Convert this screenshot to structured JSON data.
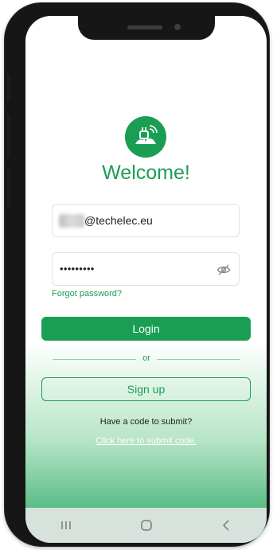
{
  "welcome": {
    "title": "Welcome!"
  },
  "email": {
    "value": "@techelec.eu"
  },
  "password": {
    "masked": "•••••••••"
  },
  "links": {
    "forgot": "Forgot password?",
    "submit_code": "Click here to submit code."
  },
  "buttons": {
    "login": "Login",
    "signup": "Sign up"
  },
  "divider": {
    "label": "or"
  },
  "code_prompt": "Have a code to submit?",
  "icons": {
    "logo": "ev-charger-plug-logo",
    "password_toggle": "eye-slash-icon",
    "nav_recents": "recent-apps-icon",
    "nav_home": "home-icon",
    "nav_back": "back-icon"
  },
  "colors": {
    "brand_green": "#1a9e53",
    "divider_green": "#8fcfa8",
    "navbar": "#d8e2dc"
  }
}
